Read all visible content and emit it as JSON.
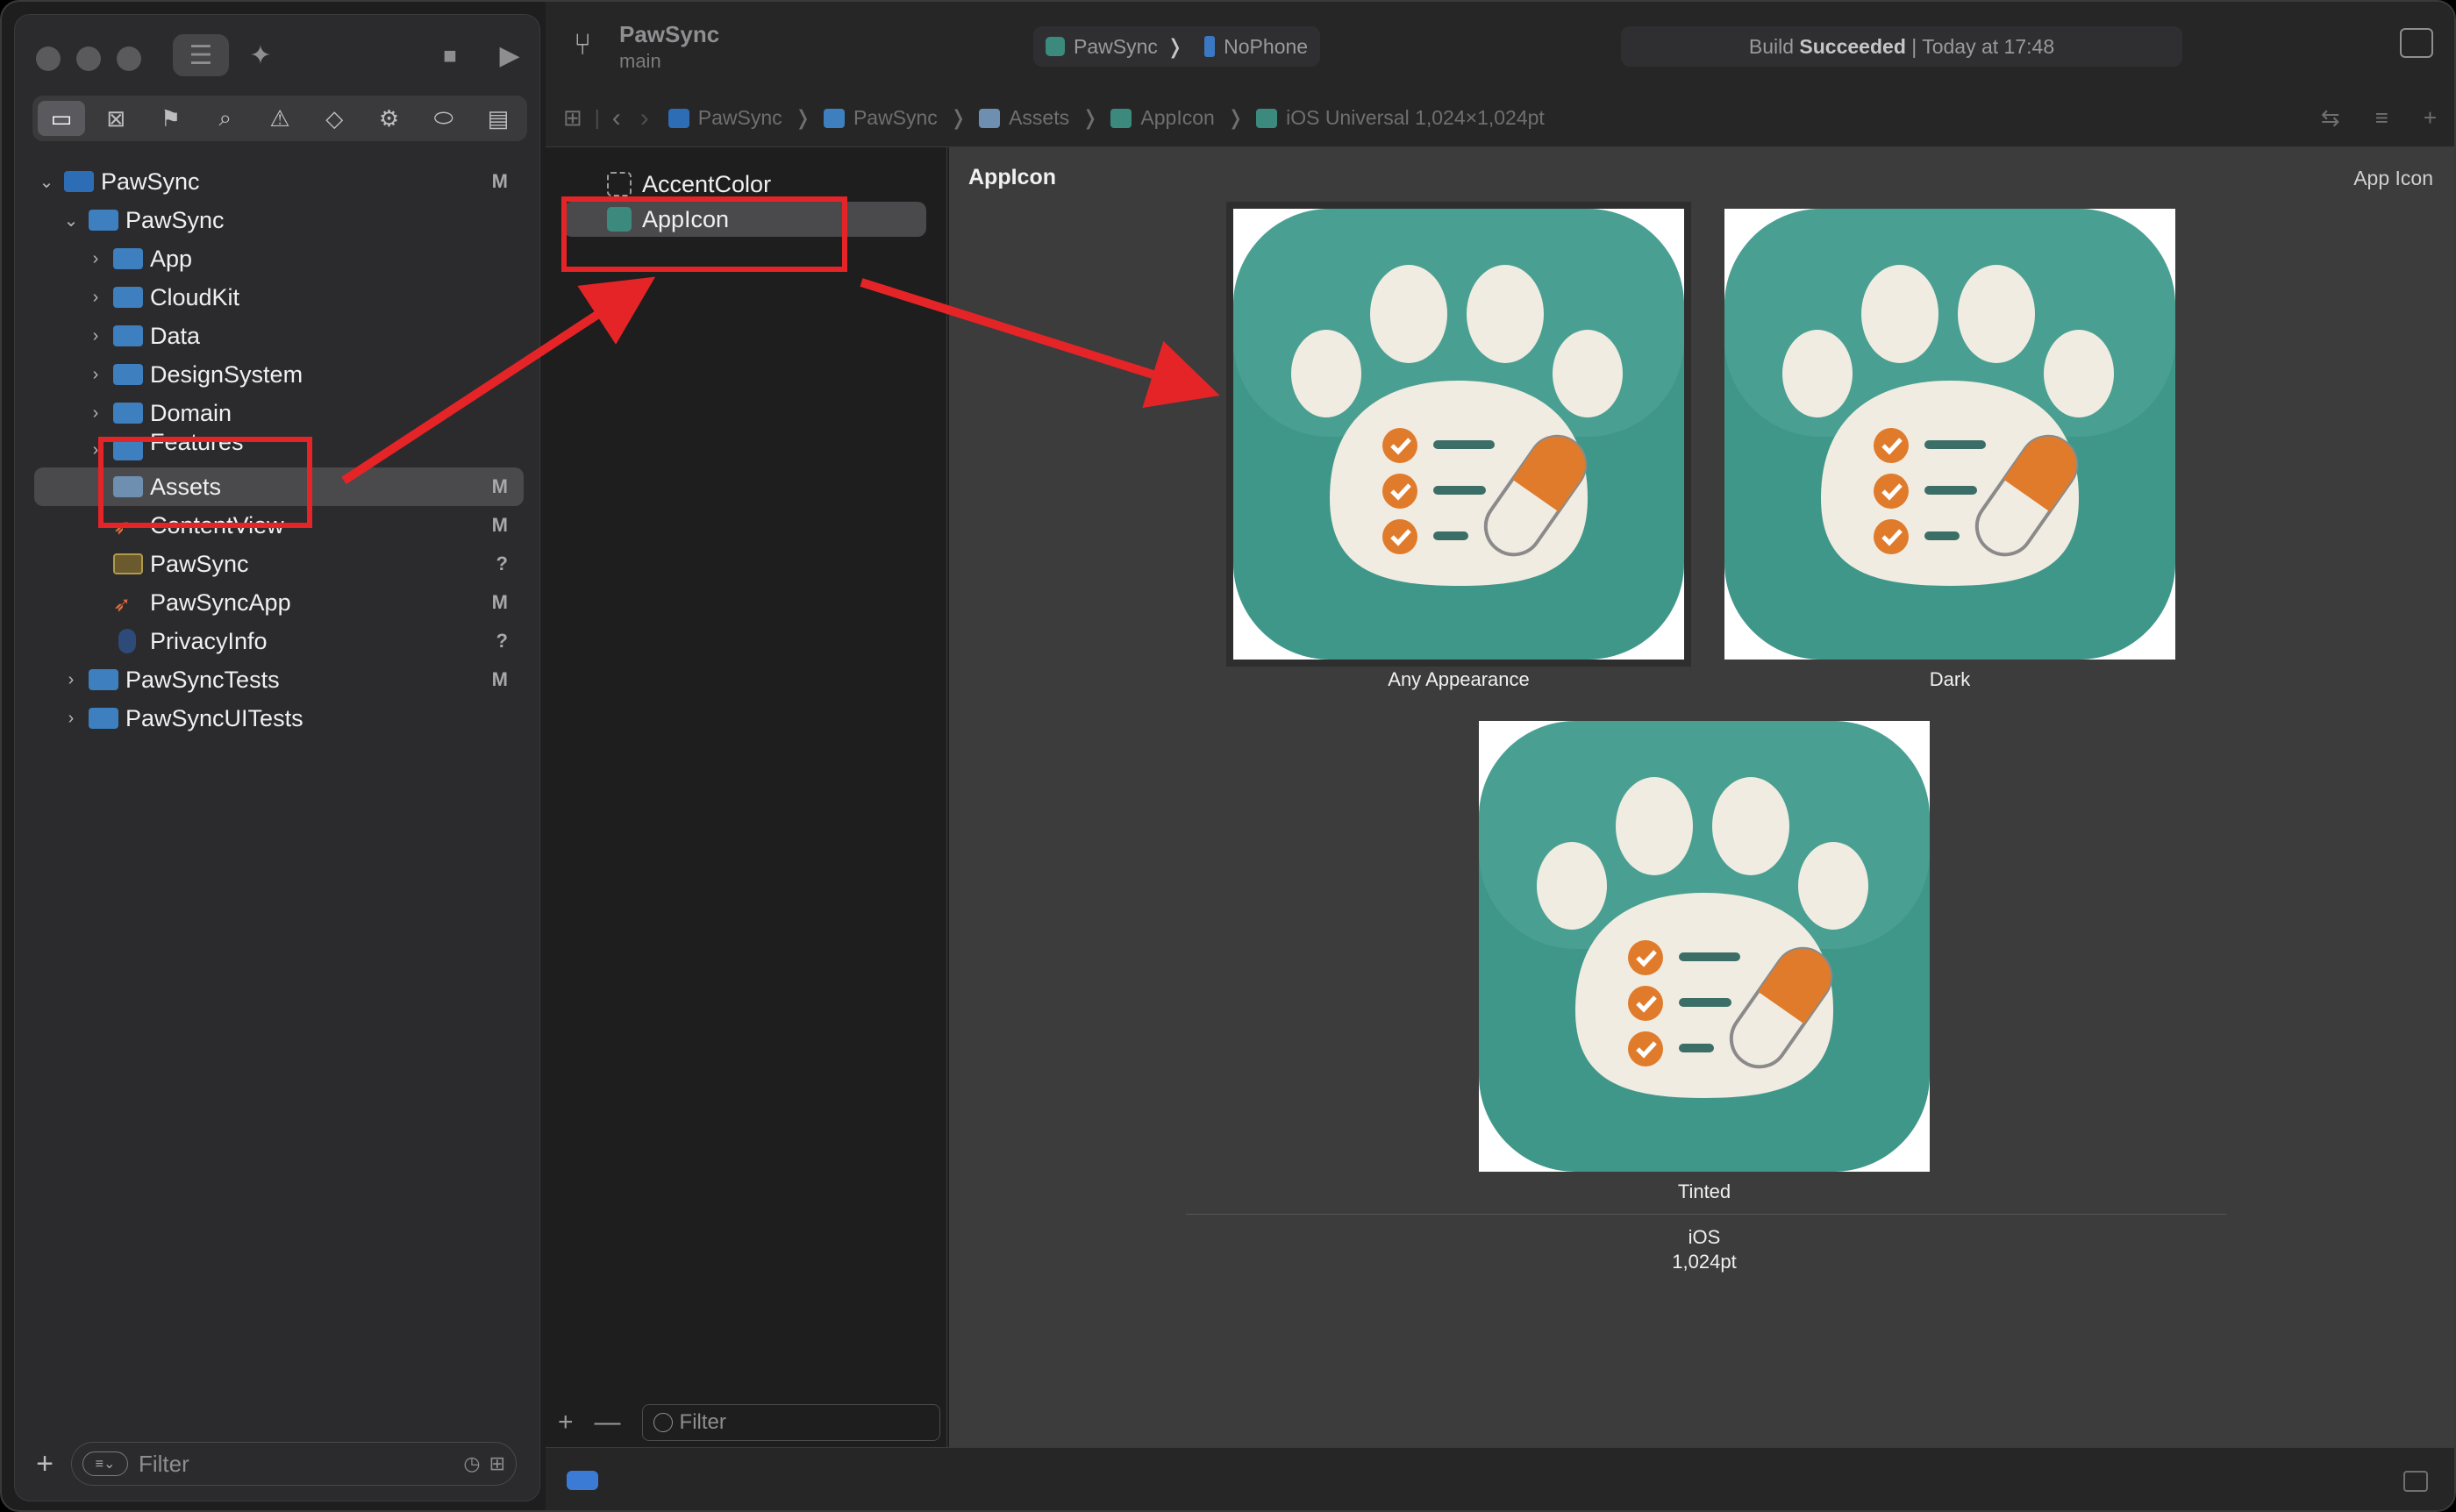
{
  "colors": {
    "accent": "#3b7bd6",
    "annotation": "#e52427",
    "icon_teal": "#3c8a7e",
    "icon_orange": "#e07b2b"
  },
  "toolbar": {
    "project_name": "PawSync",
    "branch": "main",
    "scheme_target": "PawSync",
    "scheme_device": "NoPhone",
    "status_prefix": "Build",
    "status_strong": "Succeeded",
    "status_suffix": "| Today at 17:48"
  },
  "jump_bar": [
    "PawSync",
    "PawSync",
    "Assets",
    "AppIcon",
    "iOS Universal 1,024×1,024pt"
  ],
  "navigator": {
    "items": [
      {
        "label": "PawSync",
        "status": "M"
      },
      {
        "label": "PawSync",
        "status": ""
      },
      {
        "label": "App",
        "status": ""
      },
      {
        "label": "CloudKit",
        "status": ""
      },
      {
        "label": "Data",
        "status": ""
      },
      {
        "label": "DesignSystem",
        "status": ""
      },
      {
        "label": "Domain",
        "status": ""
      },
      {
        "label": "Features",
        "status": ""
      },
      {
        "label": "Assets",
        "status": "M"
      },
      {
        "label": "ContentView",
        "status": "M"
      },
      {
        "label": "PawSync",
        "status": "?"
      },
      {
        "label": "PawSyncApp",
        "status": "M"
      },
      {
        "label": "PrivacyInfo",
        "status": "?"
      },
      {
        "label": "PawSyncTests",
        "status": "M"
      },
      {
        "label": "PawSyncUITests",
        "status": ""
      }
    ],
    "filter_placeholder": "Filter"
  },
  "asset_list": {
    "items": [
      {
        "label": "AccentColor"
      },
      {
        "label": "AppIcon"
      }
    ],
    "filter_placeholder": "Filter"
  },
  "editor": {
    "title": "AppIcon",
    "inspector_label": "App Icon",
    "slots": [
      {
        "label": "Any Appearance"
      },
      {
        "label": "Dark"
      },
      {
        "label": "Tinted"
      }
    ],
    "platform": "iOS",
    "size": "1,024pt"
  }
}
